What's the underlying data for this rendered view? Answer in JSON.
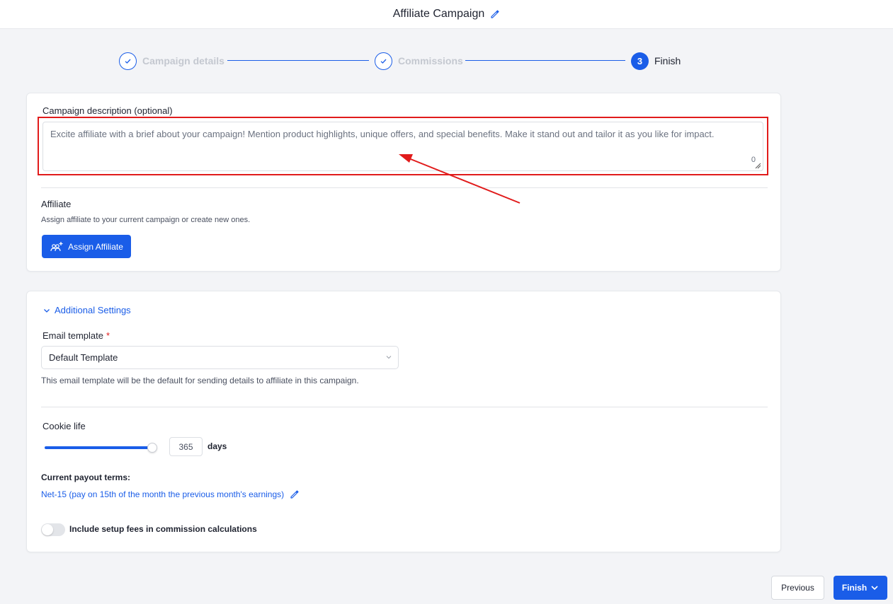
{
  "header": {
    "title": "Affiliate Campaign",
    "edit_icon": "pencil-icon"
  },
  "stepper": {
    "steps": [
      {
        "label": "Campaign details",
        "state": "done",
        "icon": "check-icon"
      },
      {
        "label": "Commissions",
        "state": "done",
        "icon": "check-icon"
      },
      {
        "label": "Finish",
        "number": "3",
        "state": "active"
      }
    ]
  },
  "description": {
    "label": "Campaign description (optional)",
    "placeholder": "Excite affiliate with a brief about your campaign! Mention product highlights, unique offers, and special benefits. Make it stand out and tailor it as you like for impact.",
    "value": "",
    "count": "0"
  },
  "affiliate": {
    "title": "Affiliate",
    "hint": "Assign affiliate to your current campaign or create new ones.",
    "assign_label": "Assign Affiliate",
    "assign_icon": "users-plus-icon"
  },
  "additional": {
    "toggle_label": "Additional Settings",
    "email_template": {
      "label": "Email template",
      "required_mark": "*",
      "selected": "Default Template",
      "hint": "This email template will be the default for sending details to affiliate in this campaign."
    },
    "cookie": {
      "label": "Cookie life",
      "value": "365",
      "unit": "days",
      "slider_level": 1.0
    },
    "payout": {
      "label": "Current payout terms:",
      "value": "Net-15 (pay on 15th of the month the previous month's earnings)"
    },
    "setup_fees": {
      "label": "Include setup fees in commission calculations",
      "enabled": false
    }
  },
  "footer": {
    "previous_label": "Previous",
    "finish_label": "Finish"
  },
  "colors": {
    "accent": "#1a5de8",
    "highlight": "#e11b1b",
    "background": "#f3f4f7"
  }
}
